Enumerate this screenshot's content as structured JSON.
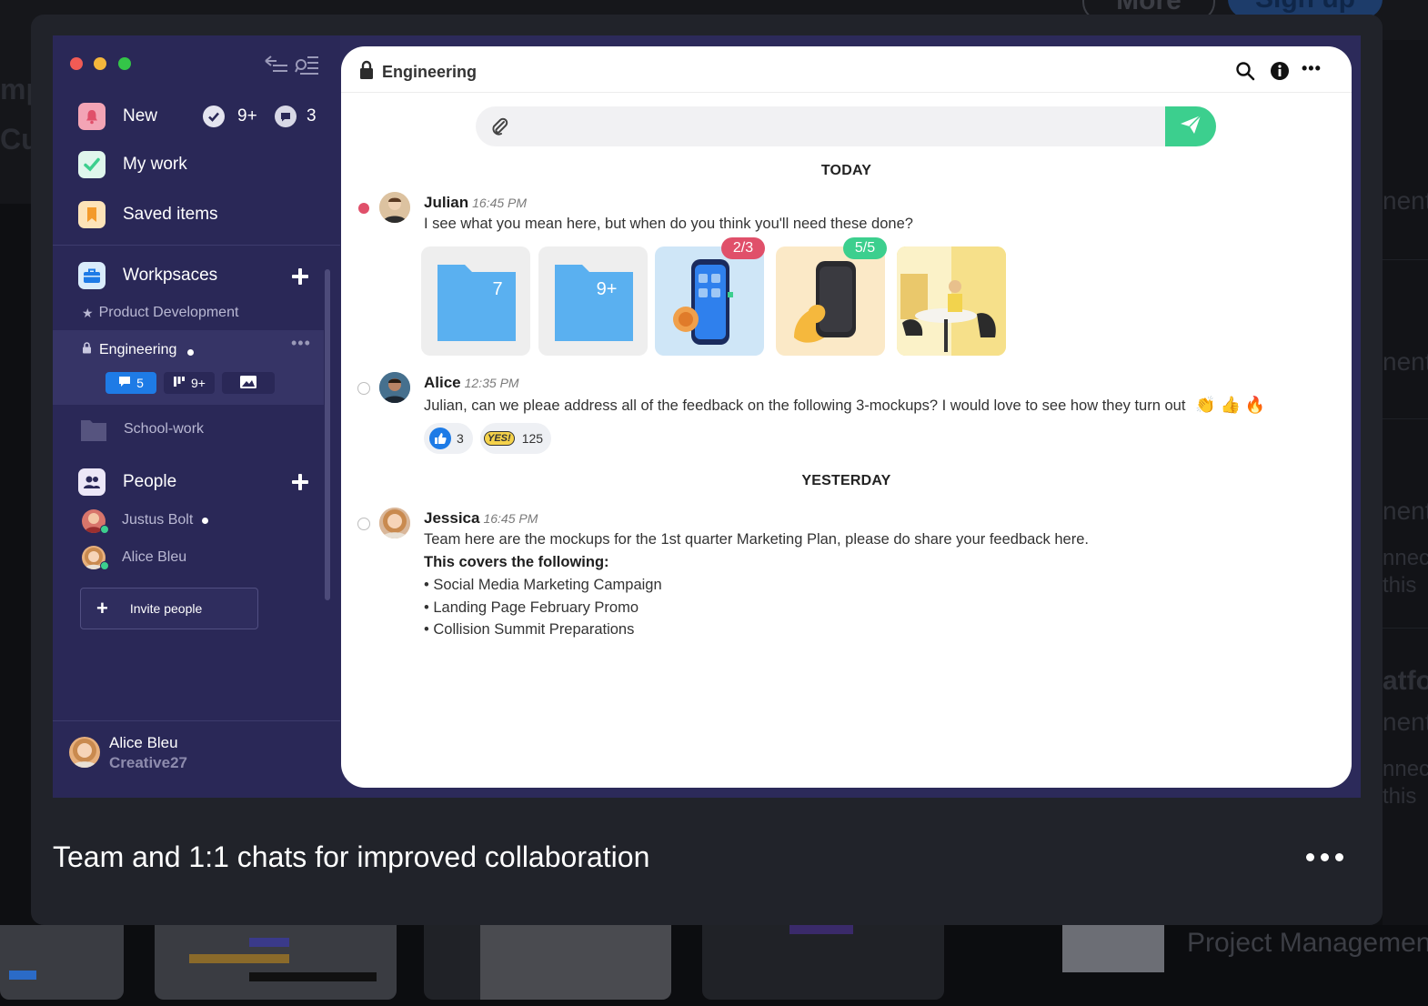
{
  "backdrop": {
    "more_button": "More",
    "signup_button": "Sign up",
    "left_words": [
      "mp",
      "Cu"
    ],
    "right_words": [
      "nent",
      "nent",
      "nent",
      "nnec",
      "this",
      "atfo",
      "nent",
      "nnec",
      "this"
    ],
    "project_management": "Project Management"
  },
  "sidebar": {
    "new_label": "New",
    "new_check_count": "9+",
    "new_chat_count": "3",
    "my_work_label": "My work",
    "saved_items_label": "Saved items",
    "workspaces_label": "Workpsaces",
    "product_development": "Product Development",
    "engineering": "Engineering",
    "engineering_chats": "5",
    "engineering_boards": "9+",
    "school_work": "School-work",
    "people_label": "People",
    "people": [
      "Justus Bolt",
      "Alice Bleu"
    ],
    "invite_label": "Invite people",
    "profile_name": "Alice Bleu",
    "profile_team": "Creative27"
  },
  "chat": {
    "title": "Engineering",
    "day_today": "TODAY",
    "day_yesterday": "YESTERDAY",
    "messages": [
      {
        "name": "Julian",
        "time": "16:45 PM",
        "text": "I see what you mean here, but when do you think you'll need these done?",
        "attachments": [
          {
            "type": "folder",
            "count": "7"
          },
          {
            "type": "folder",
            "count": "9+"
          },
          {
            "type": "image",
            "badge": "2/3"
          },
          {
            "type": "image",
            "badge": "5/5"
          },
          {
            "type": "image"
          }
        ]
      },
      {
        "name": "Alice",
        "time": "12:35 PM",
        "text": "Julian, can we pleae address all of the feedback on the following 3-mockups? I would love to see how they turn out",
        "emojis": "👏 👍 🔥",
        "reactions": [
          {
            "icon": "thumbs-up-icon",
            "count": "3"
          },
          {
            "icon": "yes-sticker-icon",
            "label": "YES!",
            "count": "125"
          }
        ]
      },
      {
        "name": "Jessica",
        "time": "16:45 PM",
        "text": "Team here are the mockups for the 1st quarter Marketing Plan, please do share your feedback here.",
        "bold_line": "This covers the following:",
        "bullets": [
          "• Social Media Marketing Campaign",
          "• Landing Page February Promo",
          "• Collision Summit Preparations"
        ]
      }
    ]
  },
  "caption": "Team and 1:1 chats for improved collaboration",
  "colors": {
    "sidebar_bg": "#2a2857",
    "accent_green": "#3ccf8e",
    "accent_blue": "#1e7be6",
    "badge_red": "#e0506a",
    "badge_green": "#3ccf8e",
    "folder_blue": "#5ab0f0"
  }
}
